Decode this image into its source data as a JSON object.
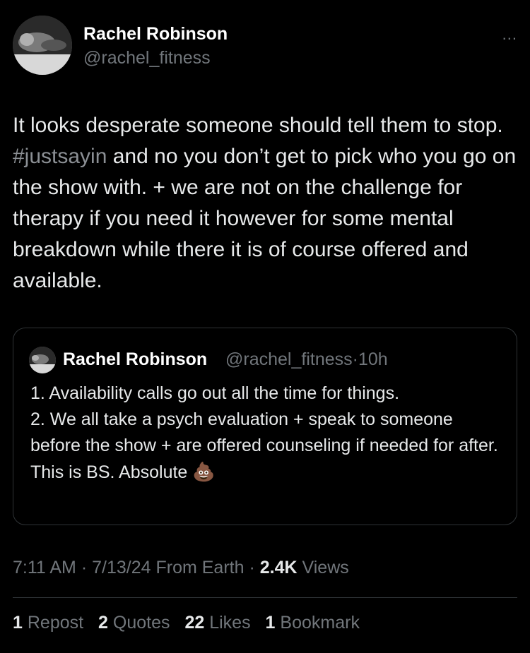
{
  "tweet": {
    "author_name": "Rachel Robinson",
    "author_handle": "@rachel_fitness",
    "more_icon": "...",
    "text_part1": "It looks desperate someone should tell them to stop. ",
    "hashtag": "#justsayin",
    "text_part2": " and no you don’t get to pick who you go on the show with. + we are not on the challenge for therapy if you need it however for some mental breakdown while there it is of course offered and available."
  },
  "quoted": {
    "author_name": "Rachel Robinson",
    "author_handle": "@rachel_fitness",
    "separator": "·",
    "time": "10h",
    "line1": "1. Availability calls go out all the time for things.",
    "line2": "2. We all take a psych evaluation + speak to someone before the show + are offered counseling if needed for after.",
    "line3": "This is BS. Absolute",
    "emoji": "💩"
  },
  "meta": {
    "time": "7:11 AM",
    "sep1": "·",
    "date": "7/13/24",
    "source": "From Earth",
    "sep2": "·",
    "views_count": "2.4K",
    "views_label": "Views"
  },
  "stats": {
    "reposts_count": "1",
    "reposts_label": "Repost",
    "quotes_count": "2",
    "quotes_label": "Quotes",
    "likes_count": "22",
    "likes_label": "Likes",
    "bookmarks_count": "1",
    "bookmarks_label": "Bookmark"
  }
}
